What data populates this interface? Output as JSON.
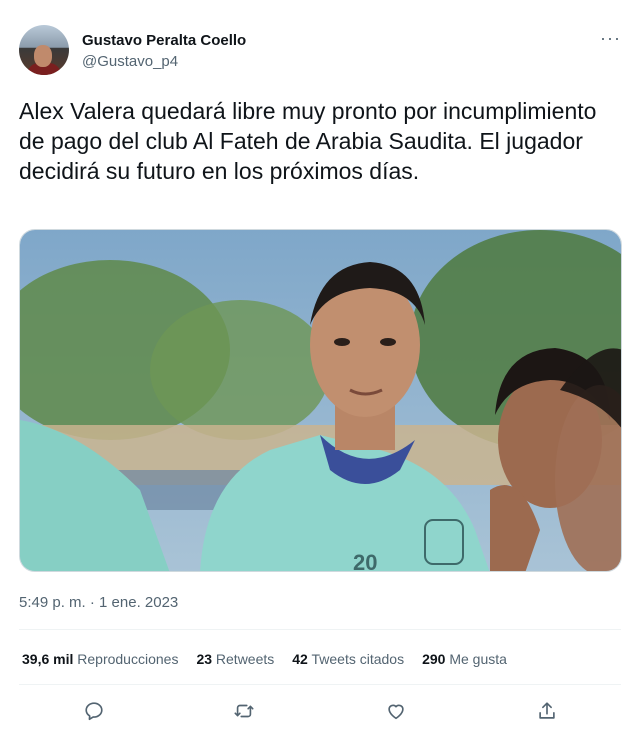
{
  "author": {
    "name": "Gustavo Peralta Coello",
    "handle": "@Gustavo_p4"
  },
  "more_menu_label": "···",
  "tweet": {
    "text": "Alex Valera quedará libre muy pronto por incumplimiento de pago del club Al Fateh de Arabia Saudita. El jugador decidirá su futuro en los próximos días."
  },
  "media": {
    "jersey_number": "20"
  },
  "timestamp": "5:49 p. m. · 1 ene. 2023",
  "stats": {
    "views": {
      "count": "39,6 mil",
      "label": "Reproducciones"
    },
    "retweets": {
      "count": "23",
      "label": "Retweets"
    },
    "quotes": {
      "count": "42",
      "label": "Tweets citados"
    },
    "likes": {
      "count": "290",
      "label": "Me gusta"
    }
  },
  "actions": {
    "reply_icon": "reply-icon",
    "retweet_icon": "retweet-icon",
    "like_icon": "heart-icon",
    "share_icon": "share-icon"
  },
  "colors": {
    "text": "#0f1419",
    "secondary": "#536471",
    "border": "#eff3f4",
    "jersey": "#8fd5cc"
  }
}
